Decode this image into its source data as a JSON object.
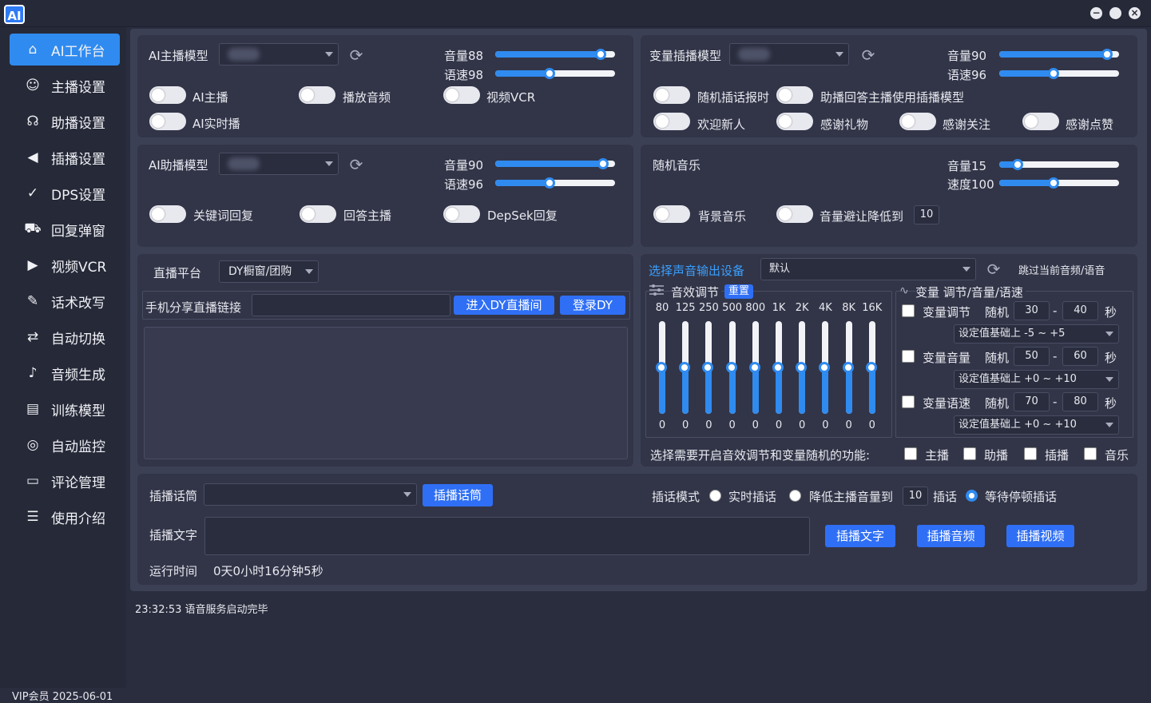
{
  "app": {
    "logo": "AI"
  },
  "sidebar": {
    "items": [
      {
        "label": "AI工作台",
        "icon": "home-icon"
      },
      {
        "label": "主播设置",
        "icon": "host-icon"
      },
      {
        "label": "助播设置",
        "icon": "headset-icon"
      },
      {
        "label": "插播设置",
        "icon": "speaker-icon"
      },
      {
        "label": "DPS设置",
        "icon": "dps-icon"
      },
      {
        "label": "回复弹窗",
        "icon": "cart-icon"
      },
      {
        "label": "视频VCR",
        "icon": "video-icon"
      },
      {
        "label": "话术改写",
        "icon": "magic-pen-icon"
      },
      {
        "label": "自动切换",
        "icon": "switch-icon"
      },
      {
        "label": "音频生成",
        "icon": "music-file-icon"
      },
      {
        "label": "训练模型",
        "icon": "archive-icon"
      },
      {
        "label": "自动监控",
        "icon": "monitor-icon"
      },
      {
        "label": "评论管理",
        "icon": "comment-icon"
      },
      {
        "label": "使用介绍",
        "icon": "document-icon"
      }
    ],
    "vip": "VIP会员  2025-06-01"
  },
  "host_panel": {
    "model_label": "AI主播模型",
    "vol_label": "音量88",
    "vol": 88,
    "speed_label": "语速98",
    "speed": 45,
    "toggles": [
      "AI主播",
      "播放音频",
      "视频VCR",
      "AI实时播"
    ]
  },
  "var_panel": {
    "model_label": "变量插播模型",
    "vol_label": "音量90",
    "vol": 90,
    "speed_label": "语速96",
    "speed": 45,
    "toggles": [
      "随机插话报时",
      "助播回答主播使用插播模型",
      "欢迎新人",
      "感谢礼物",
      "感谢关注",
      "感谢点赞"
    ]
  },
  "assist_panel": {
    "model_label": "AI助播模型",
    "vol_label": "音量90",
    "vol": 90,
    "speed_label": "语速96",
    "speed": 45,
    "toggles": [
      "关键词回复",
      "回答主播",
      "DepSek回复"
    ]
  },
  "music_panel": {
    "title": "随机音乐",
    "vol_label": "音量15",
    "vol": 15,
    "speed_label": "速度100",
    "speed": 45,
    "toggles": [
      "背景音乐",
      "音量避让降低到"
    ],
    "duck_value": "10"
  },
  "platform_panel": {
    "label": "直播平台",
    "platform": "DY橱窗/团购",
    "link_label": "手机分享直播链接",
    "link_value": "",
    "enter_btn": "进入DY直播间",
    "login_btn": "登录DY"
  },
  "audio_panel": {
    "device_label": "选择声音输出设备",
    "device": "默认",
    "skip": "跳过当前音频/语音",
    "eq_title": "音效调节",
    "reset": "重置",
    "bands": [
      "80",
      "125",
      "250",
      "500",
      "800",
      "1K",
      "2K",
      "4K",
      "8K",
      "16K"
    ],
    "gains": [
      "0",
      "0",
      "0",
      "0",
      "0",
      "0",
      "0",
      "0",
      "0",
      "0"
    ],
    "var_title": "变量 调节/音量/语速",
    "var_rows": [
      {
        "label": "变量调节",
        "rand": "随机",
        "a": "30",
        "b": "40",
        "unit": "秒",
        "dash": "-",
        "range": "设定值基础上 -5 ~ +5"
      },
      {
        "label": "变量音量",
        "rand": "随机",
        "a": "50",
        "b": "60",
        "unit": "秒",
        "dash": "-",
        "range": "设定值基础上 +0 ~ +10"
      },
      {
        "label": "变量语速",
        "rand": "随机",
        "a": "70",
        "b": "80",
        "unit": "秒",
        "dash": "-",
        "range": "设定值基础上 +0 ~ +10"
      }
    ],
    "apply_label": "选择需要开启音效调节和变量随机的功能:",
    "apply": [
      "主播",
      "助播",
      "插播",
      "音乐"
    ]
  },
  "insert_panel": {
    "script_label": "插播话筒",
    "script_btn": "插播话筒",
    "mode_label": "插话模式",
    "modes": [
      "实时插话",
      "降低主播音量到",
      "插话",
      "等待停顿插话"
    ],
    "lower_value": "10",
    "text_label": "插播文字",
    "btn_text": "插播文字",
    "btn_audio": "插播音频",
    "btn_video": "插播视频",
    "runtime_label": "运行时间",
    "runtime": "0天0小时16分钟5秒"
  },
  "log": {
    "line": "23:32:53 语音服务启动完毕"
  }
}
